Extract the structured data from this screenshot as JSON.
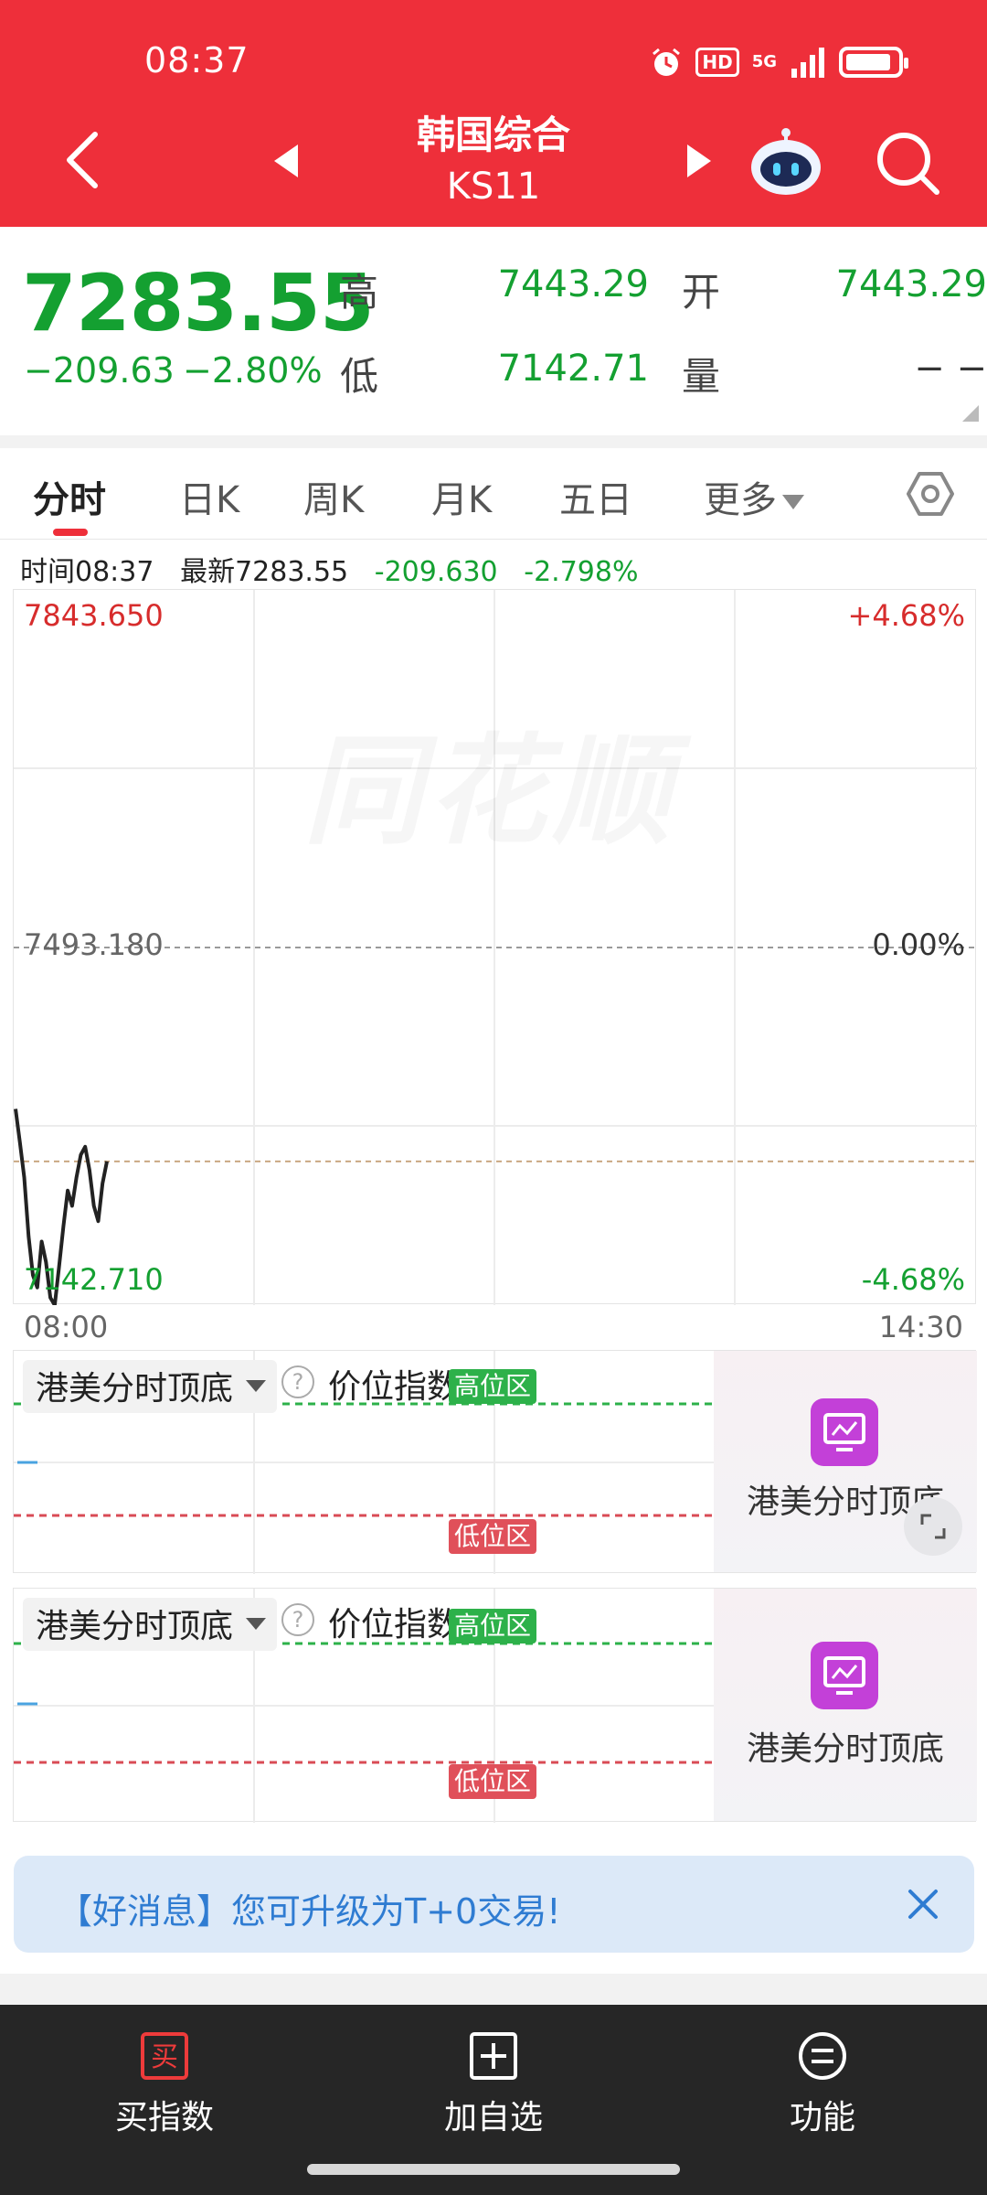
{
  "status_bar": {
    "time": "08:37",
    "hd": "HD",
    "network": "5G"
  },
  "header": {
    "title": "韩国综合",
    "code": "KS11"
  },
  "quote": {
    "price": "7283.55",
    "change": "−209.63",
    "change_pct": "−2.80%",
    "high_label": "高",
    "high_value": "7443.29",
    "low_label": "低",
    "low_value": "7142.71",
    "open_label": "开",
    "open_value": "7443.29",
    "volume_label": "量",
    "volume_value": "− −"
  },
  "tabs": [
    {
      "label": "分时",
      "active": true
    },
    {
      "label": "日K"
    },
    {
      "label": "周K"
    },
    {
      "label": "月K"
    },
    {
      "label": "五日"
    },
    {
      "label": "更多"
    }
  ],
  "info_bar": {
    "time": "时间08:37",
    "latest": "最新7283.55",
    "change": "-209.630",
    "change_pct": "-2.798%"
  },
  "chart": {
    "watermark": "同花顺",
    "y_max": "7843.650",
    "y_mid": "7493.180",
    "y_min": "7142.710",
    "pct_max": "+4.68%",
    "pct_mid": "0.00%",
    "pct_min": "-4.68%",
    "time_start": "08:00",
    "time_end": "14:30",
    "colors": {
      "up": "#d72c2c",
      "down": "#14a031",
      "line": "#222222"
    }
  },
  "chart_data": {
    "type": "line",
    "x": [
      "08:00",
      "08:37"
    ],
    "y_axis": {
      "min": 7142.71,
      "max": 7843.65,
      "prev_close": 7493.18
    },
    "current_price": 7283.55,
    "ylim": [
      7142.71,
      7843.65
    ],
    "xlim": [
      "08:00",
      "14:30"
    ],
    "series": [
      {
        "values": [
          7335,
          7302,
          7268,
          7210,
          7172,
          7160,
          7205,
          7185,
          7150,
          7142.71,
          7180,
          7220,
          7255,
          7240,
          7268,
          7290,
          7298,
          7275,
          7240,
          7225,
          7262,
          7283.55
        ]
      }
    ]
  },
  "indicators": [
    {
      "name": "港美分时顶底",
      "sub": "价位指数",
      "high_zone": "高位区",
      "low_zone": "低位区",
      "promo_label": "港美分时顶底"
    },
    {
      "name": "港美分时顶底",
      "sub": "价位指数",
      "high_zone": "高位区",
      "low_zone": "低位区",
      "promo_label": "港美分时顶底"
    }
  ],
  "banner": {
    "text": "【好消息】您可升级为T+0交易!"
  },
  "bottom_nav": [
    {
      "label": "买指数",
      "icon": "buy-icon",
      "icon_char": "买"
    },
    {
      "label": "加自选",
      "icon": "add-favorite-icon"
    },
    {
      "label": "功能",
      "icon": "menu-icon"
    }
  ]
}
